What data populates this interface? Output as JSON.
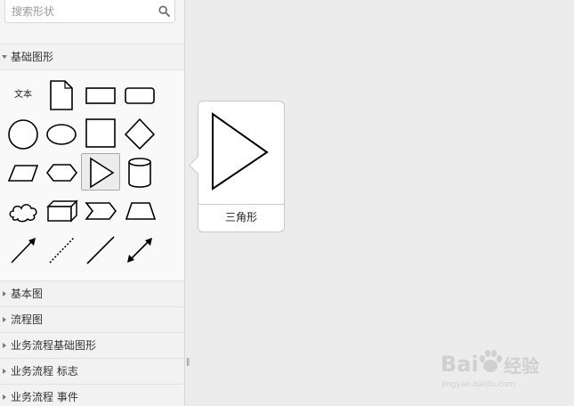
{
  "search": {
    "placeholder": "搜索形状"
  },
  "sections": [
    {
      "label": "基础图形",
      "expanded": true
    },
    {
      "label": "基本图",
      "expanded": false
    },
    {
      "label": "流程图",
      "expanded": false
    },
    {
      "label": "业务流程基础图形",
      "expanded": false
    },
    {
      "label": "业务流程 标志",
      "expanded": false
    },
    {
      "label": "业务流程 事件",
      "expanded": false
    }
  ],
  "shapes": {
    "text_label": "文本",
    "items": [
      "text",
      "document",
      "rectangle",
      "rounded-rectangle",
      "circle",
      "ellipse",
      "square",
      "diamond",
      "parallelogram",
      "hexagon",
      "triangle",
      "cylinder",
      "cloud",
      "cube",
      "chevron",
      "trapezoid",
      "arrow",
      "dotted-line",
      "line",
      "bidirectional-arrow"
    ],
    "selected": "triangle"
  },
  "tooltip": {
    "label": "三角形"
  },
  "splitter": {
    "glyph": "‖"
  },
  "watermark": {
    "brand": "Bai",
    "brand2": "经验",
    "url": "jingyan.baidu.com"
  },
  "colors": {
    "sidebar_bg": "#f5f5f5",
    "canvas_bg": "#ececec",
    "selected_border": "#a8a8a8"
  }
}
